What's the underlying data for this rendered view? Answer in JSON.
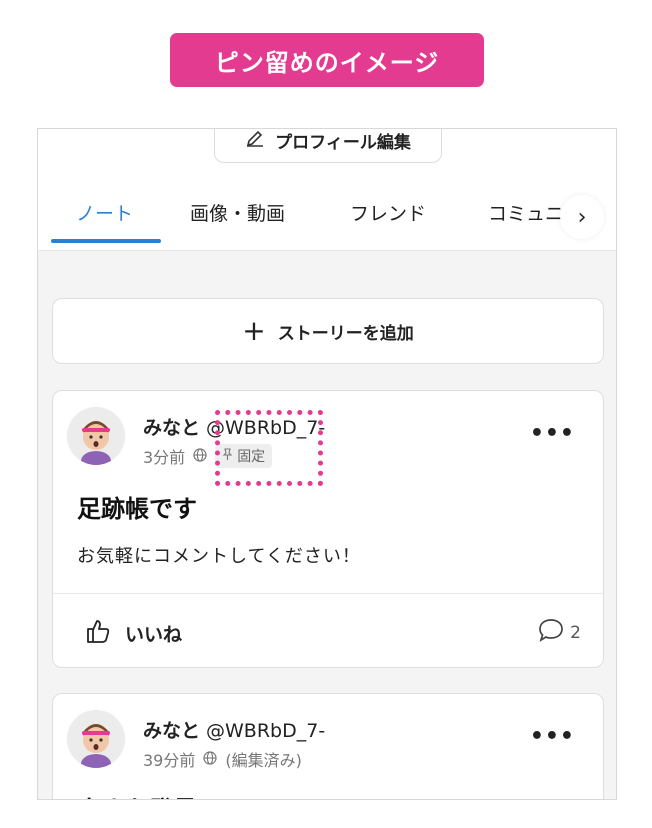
{
  "banner": {
    "text": "ピン留めのイメージ"
  },
  "header": {
    "edit_profile_label": "プロフィール編集"
  },
  "tabs": [
    {
      "label": "ノート",
      "active": true
    },
    {
      "label": "画像・動画"
    },
    {
      "label": "フレンド"
    },
    {
      "label": "コミュニ"
    }
  ],
  "story": {
    "add_label": "ストーリーを追加"
  },
  "posts": [
    {
      "author": "みなと",
      "handle": "@WBRbD_7-",
      "time": "3分前",
      "pinned_label": "固定",
      "title": "足跡帳です",
      "body": "お気軽にコメントしてください！",
      "like_label": "いいね",
      "comment_count": "2"
    },
    {
      "author": "みなと",
      "handle": "@WBRbD_7-",
      "time": "39分前",
      "status": "(編集済み)",
      "title": "小さな発見"
    }
  ],
  "colors": {
    "accent": "#e33b8f",
    "tab_active": "#2f7fd1"
  }
}
